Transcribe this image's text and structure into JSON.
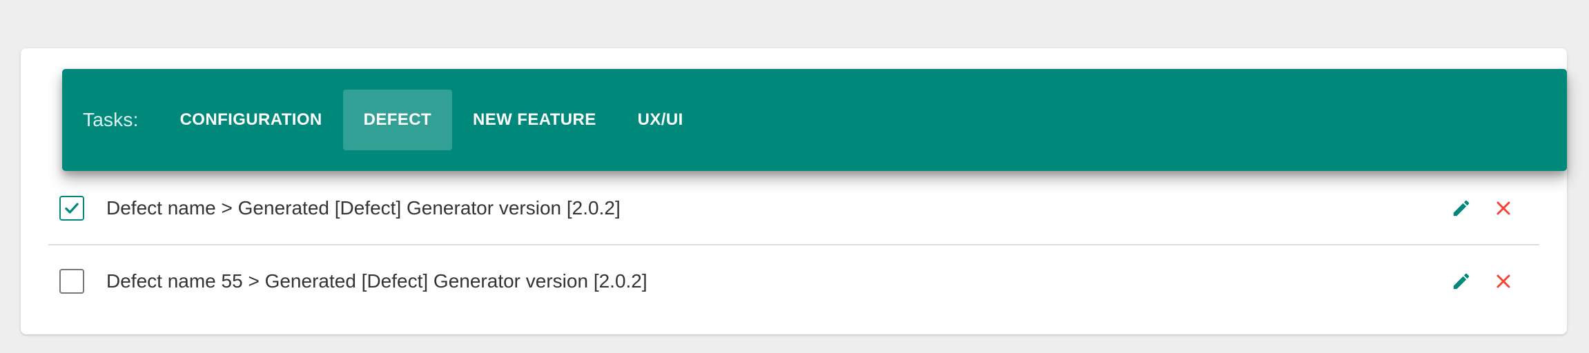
{
  "header": {
    "title": "Tasks:",
    "tabs": [
      {
        "label": "CONFIGURATION",
        "active": false
      },
      {
        "label": "DEFECT",
        "active": true
      },
      {
        "label": "NEW FEATURE",
        "active": false
      },
      {
        "label": "UX/UI",
        "active": false
      }
    ]
  },
  "tasks": [
    {
      "label": "Defect name > Generated [Defect] Generator version [2.0.2]",
      "checked": true
    },
    {
      "label": "Defect name 55 > Generated [Defect] Generator version [2.0.2]",
      "checked": false
    }
  ],
  "icons": {
    "edit": "pencil-icon",
    "delete": "close-icon",
    "check": "check-icon"
  },
  "colors": {
    "primary": "#00897b",
    "delete": "#f44336",
    "background": "#eeeeee",
    "text": "#333333"
  }
}
